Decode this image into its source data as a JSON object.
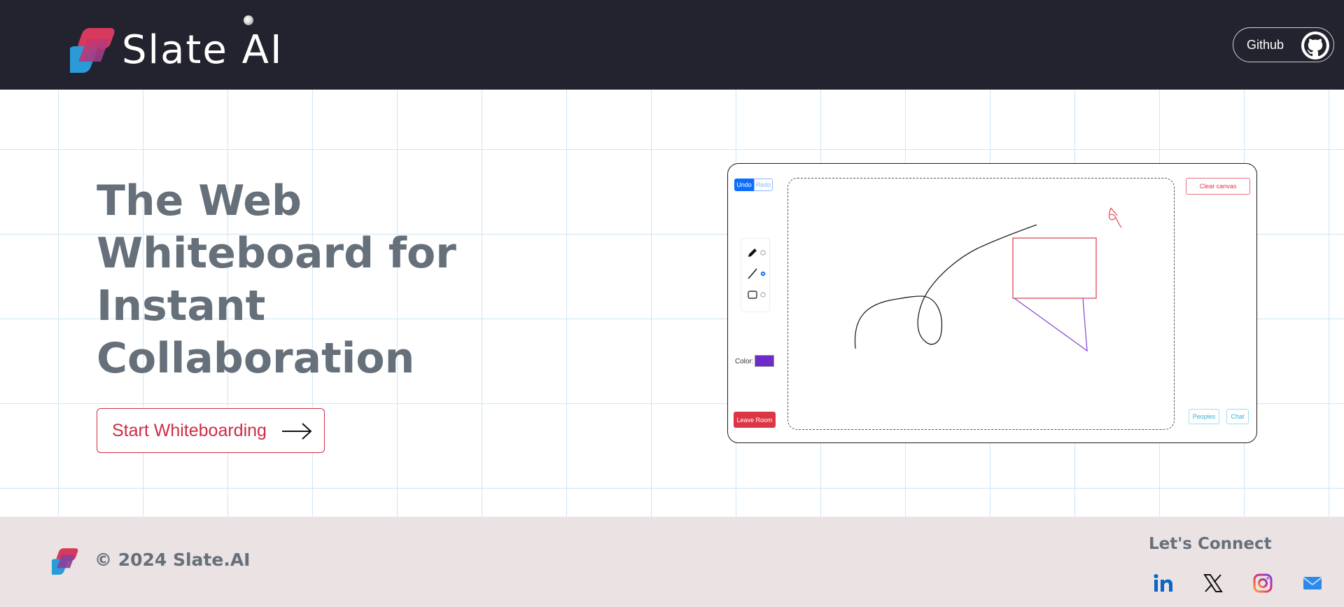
{
  "header": {
    "brand": "Slate AI",
    "github_label": "Github"
  },
  "hero": {
    "headline": "The Web Whiteboard for Instant Collaboration",
    "cta_label": "Start Whiteboarding"
  },
  "preview": {
    "undo": "Undo",
    "redo": "Redo",
    "color_label": "Color:",
    "selected_color": "#6d2bc9",
    "selected_tool": "line",
    "leave_room": "Leave Room",
    "clear_canvas": "Clear canvas",
    "peoples": "Peoples",
    "chat": "Chat"
  },
  "footer": {
    "copyright": "© 2024 Slate.AI",
    "connect_heading": "Let's Connect",
    "socials": [
      "linkedin-icon",
      "x-icon",
      "instagram-icon",
      "mail-icon"
    ]
  },
  "colors": {
    "header_bg": "#23232f",
    "accent_red": "#cf2c45",
    "text_gray": "#66707a",
    "footer_bg": "#eae2e3",
    "grid_line": "#cfe6f4"
  }
}
